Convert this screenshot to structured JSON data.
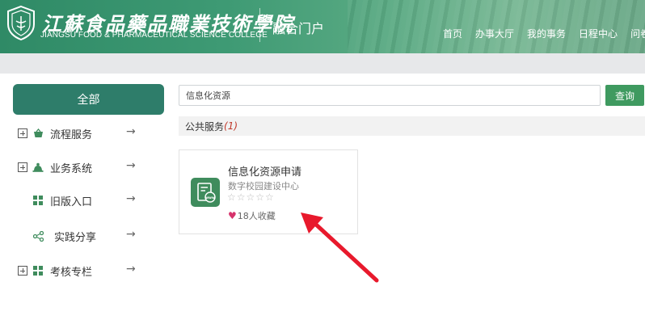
{
  "header": {
    "brand_cn": "江蘇食品藥品職業技術學院",
    "brand_en": "JIANGSU FOOD & PHARMACEUTICAL SCIENCE COLLEGE",
    "portal_title": "融合门户",
    "nav": [
      "首页",
      "办事大厅",
      "我的事务",
      "日程中心",
      "问卷"
    ]
  },
  "sidebar": {
    "all_label": "全部",
    "items": [
      {
        "label": "流程服务",
        "icon": "basket-icon",
        "expandable": true,
        "arrow": "→"
      },
      {
        "label": "业务系统",
        "icon": "hat-icon",
        "expandable": true,
        "arrow": "→"
      },
      {
        "label": "旧版入口",
        "icon": "grid-icon",
        "expandable": false,
        "arrow": "→"
      },
      {
        "label": "实践分享",
        "icon": "share-icon",
        "expandable": false,
        "arrow": "→"
      },
      {
        "label": "考核专栏",
        "icon": "grid-icon",
        "expandable": true,
        "arrow": "→"
      }
    ]
  },
  "search": {
    "value": "信息化资源",
    "button_label": "查询"
  },
  "section": {
    "title": "公共服务",
    "count": "(1)"
  },
  "card": {
    "title": "信息化资源申请",
    "department": "数字校园建设中心",
    "stars": "☆☆☆☆☆",
    "favorites": "18人收藏",
    "icon": "www-form-icon"
  },
  "colors": {
    "header_green": "#2f8a66",
    "sidebar_active": "#2e7d6a",
    "button_green": "#3f9a60",
    "icon_green": "#3f8c5d",
    "count_red": "#c0392b",
    "arrow_red": "#e8192c"
  }
}
